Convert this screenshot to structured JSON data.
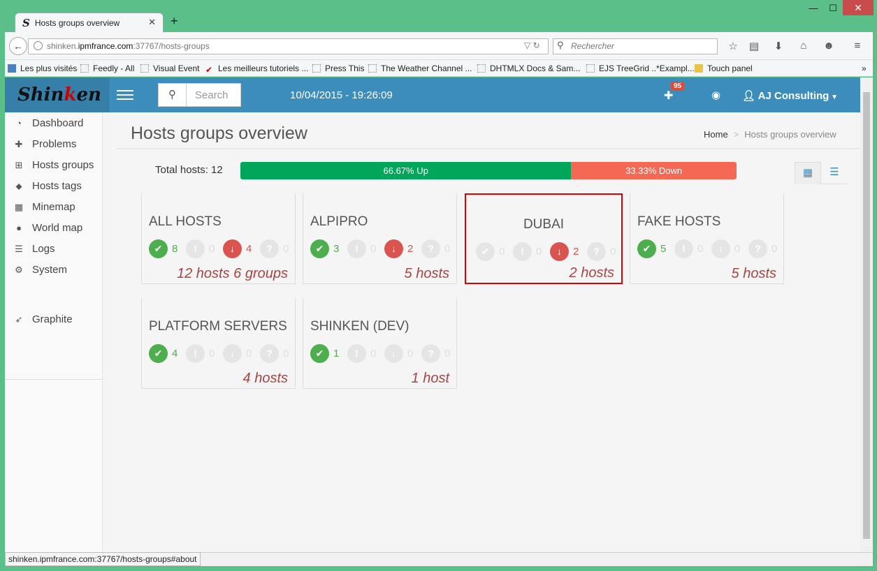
{
  "browser": {
    "tab_title": "Hosts groups overview",
    "tab_favicon": "S",
    "new_tab": "+",
    "url_host": "shinken.",
    "url_domain": "ipmfrance.com",
    "url_rest": ":37767/hosts-groups",
    "search_placeholder": "Rechercher",
    "bookmarks": [
      "Les plus visités",
      "Feedly - All",
      "Visual Event",
      "Les meilleurs tutoriels ...",
      "Press This",
      "The Weather Channel ...",
      "DHTMLX Docs & Sam...",
      "EJS TreeGrid ..*Exampl...",
      "Touch panel"
    ],
    "status_url": "shinken.ipmfrance.com:37767/hosts-groups#about"
  },
  "app": {
    "logo_a": "Shin",
    "logo_b": "k",
    "logo_c": "en",
    "search_placeholder": "Search",
    "datetime": "10/04/2015 - 19:26:09",
    "notif_count": "95",
    "user_name": "AJ Consulting"
  },
  "sidebar": {
    "items": [
      {
        "label": "Dashboard",
        "icon": "dashboard-icon"
      },
      {
        "label": "Problems",
        "icon": "ambulance-icon"
      },
      {
        "label": "Hosts groups",
        "icon": "sitemap-icon"
      },
      {
        "label": "Hosts tags",
        "icon": "tags-icon"
      },
      {
        "label": "Minemap",
        "icon": "table-icon"
      },
      {
        "label": "World map",
        "icon": "globe-icon"
      },
      {
        "label": "Logs",
        "icon": "list-icon"
      },
      {
        "label": "System",
        "icon": "gears-icon"
      }
    ],
    "extra": {
      "label": "Graphite",
      "icon": "rocket-icon"
    }
  },
  "page": {
    "title": "Hosts groups overview",
    "breadcrumb_home": "Home",
    "breadcrumb_sep": ">",
    "breadcrumb_current": "Hosts groups overview",
    "total_label": "Total hosts: 12",
    "up_label": "66.67% Up",
    "down_label": "33.33% Down",
    "up_fraction": 0.6667
  },
  "groups": [
    {
      "name": "ALL HOSTS",
      "up": "8",
      "unreach": "0",
      "down": "4",
      "unknown": "0",
      "count": "12 hosts 6 groups",
      "selected": false
    },
    {
      "name": "ALPIPRO",
      "up": "3",
      "unreach": "0",
      "down": "2",
      "unknown": "0",
      "count": "5 hosts",
      "selected": false
    },
    {
      "name": "DUBAI",
      "up": "0",
      "unreach": "0",
      "down": "2",
      "unknown": "0",
      "count": "2 hosts",
      "selected": true
    },
    {
      "name": "FAKE HOSTS",
      "up": "5",
      "unreach": "0",
      "down": "0",
      "unknown": "0",
      "count": "5 hosts",
      "selected": false
    },
    {
      "name": "PLATFORM SERVERS",
      "up": "4",
      "unreach": "0",
      "down": "0",
      "unknown": "0",
      "count": "4 hosts",
      "selected": false
    },
    {
      "name": "SHINKEN (DEV)",
      "up": "1",
      "unreach": "0",
      "down": "0",
      "unknown": "0",
      "count": "1 host",
      "selected": false
    }
  ]
}
